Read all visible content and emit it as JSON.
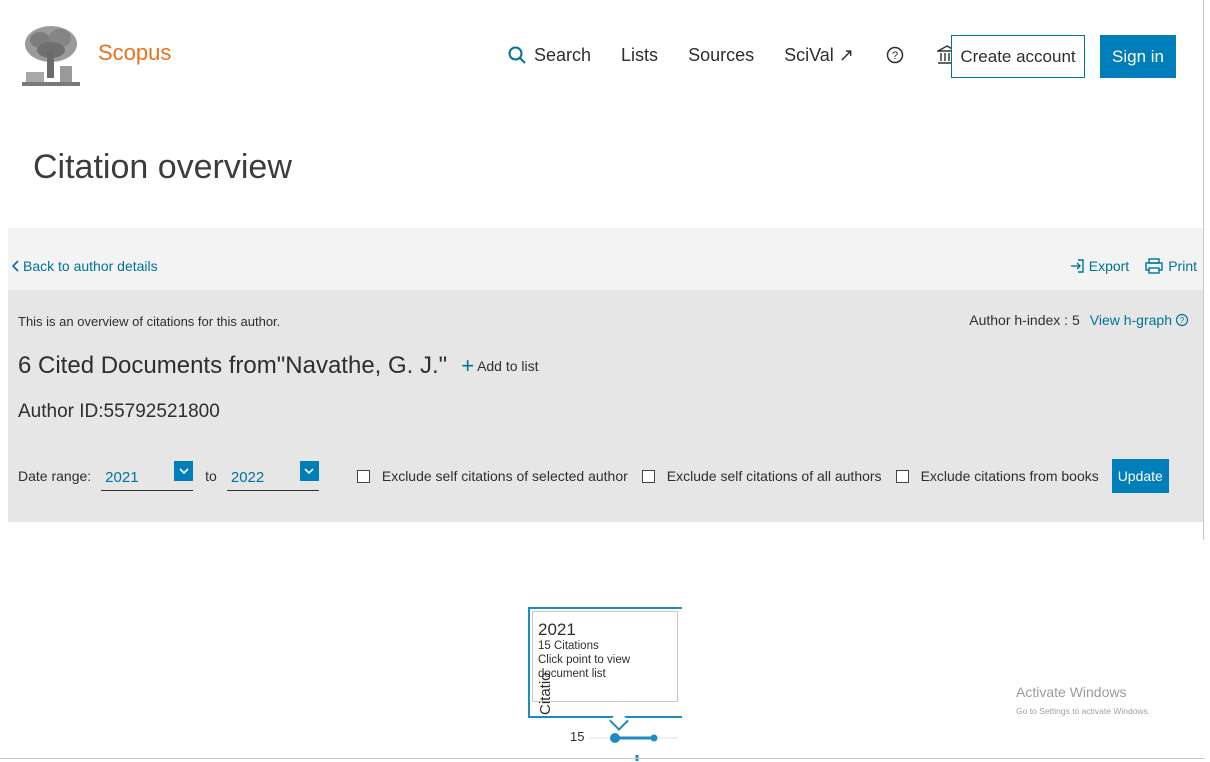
{
  "header": {
    "brand": "Scopus",
    "nav": [
      {
        "label": "Search",
        "icon": "search-icon"
      },
      {
        "label": "Lists"
      },
      {
        "label": "Sources"
      },
      {
        "label": "SciVal ↗"
      }
    ],
    "create_account": "Create account",
    "sign_in": "Sign in"
  },
  "page_title": "Citation overview",
  "toolbar": {
    "back_link": "Back to author details",
    "export": "Export",
    "print": "Print"
  },
  "overview": {
    "intro": "This is an overview of citations for this author.",
    "hindex_label": "Author h-index : 5",
    "view_hgraph": "View h-graph",
    "title": "6 Cited Documents from\"Navathe, G. J.\"",
    "add_to_list": "Add to list",
    "author_id": "Author ID:55792521800"
  },
  "filters": {
    "date_range_label": "Date range:",
    "from_year": "2021",
    "to_label": "to",
    "to_year": "2022",
    "exclude_self_selected": "Exclude self citations of selected author",
    "exclude_self_all": "Exclude self citations of all authors",
    "exclude_books": "Exclude citations from books",
    "update": "Update"
  },
  "chart": {
    "tooltip_year": "2021",
    "tooltip_citations": "15 Citations",
    "tooltip_hint": "Click point to view document list",
    "y_axis_label": "Citatio",
    "y_tick": "15"
  },
  "chart_data": {
    "type": "line",
    "title": "",
    "xlabel": "",
    "ylabel": "Citations",
    "x": [
      "2021"
    ],
    "series": [
      {
        "values": [
          15
        ]
      }
    ]
  },
  "watermark": {
    "title": "Activate Windows",
    "subtitle": "Go to Settings to activate Windows."
  },
  "colors": {
    "accent": "#007eb9",
    "brand": "#e9711c",
    "link": "#007398"
  }
}
